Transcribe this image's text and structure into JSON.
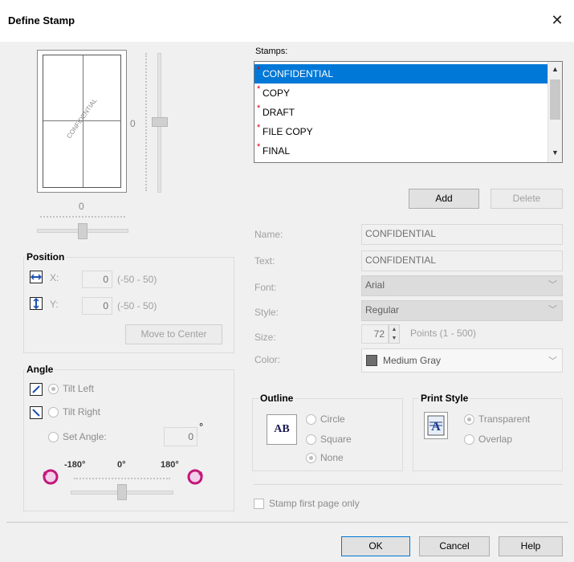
{
  "dialog": {
    "title": "Define Stamp",
    "close_glyph": "✕"
  },
  "preview": {
    "stamp_text": "CONFIDENTIAL",
    "vertical_value": "0",
    "horizontal_value": "0"
  },
  "stamps": {
    "label": "Stamps:",
    "items": [
      "CONFIDENTIAL",
      "COPY",
      "DRAFT",
      "FILE COPY",
      "FINAL"
    ],
    "star": "*",
    "add_label": "Add",
    "delete_label": "Delete"
  },
  "form": {
    "name_label": "Name:",
    "name_value": "CONFIDENTIAL",
    "text_label": "Text:",
    "text_value": "CONFIDENTIAL",
    "font_label": "Font:",
    "font_value": "Arial",
    "style_label": "Style:",
    "style_value": "Regular",
    "size_label": "Size:",
    "size_value": "72",
    "size_range": "Points (1 - 500)",
    "color_label": "Color:",
    "color_value": "Medium Gray",
    "color_swatch": "#6e6e6e"
  },
  "position": {
    "label": "Position",
    "x_label": "X:",
    "x_value": "0",
    "x_range": "(-50 - 50)",
    "y_label": "Y:",
    "y_value": "0",
    "y_range": "(-50 - 50)",
    "move_center_label": "Move to Center"
  },
  "angle": {
    "label": "Angle",
    "tilt_left": "Tilt Left",
    "tilt_right": "Tilt Right",
    "set_angle": "Set Angle:",
    "angle_value": "0",
    "degree": "°",
    "min_label": "-180°",
    "mid_label": "0°",
    "max_label": "180°"
  },
  "outline": {
    "label": "Outline",
    "icon_text": "AB",
    "circle": "Circle",
    "square": "Square",
    "none": "None"
  },
  "print_style": {
    "label": "Print Style",
    "transparent": "Transparent",
    "overlap": "Overlap"
  },
  "footer": {
    "stamp_first_page": "Stamp first page only",
    "ok": "OK",
    "cancel": "Cancel",
    "help": "Help"
  }
}
